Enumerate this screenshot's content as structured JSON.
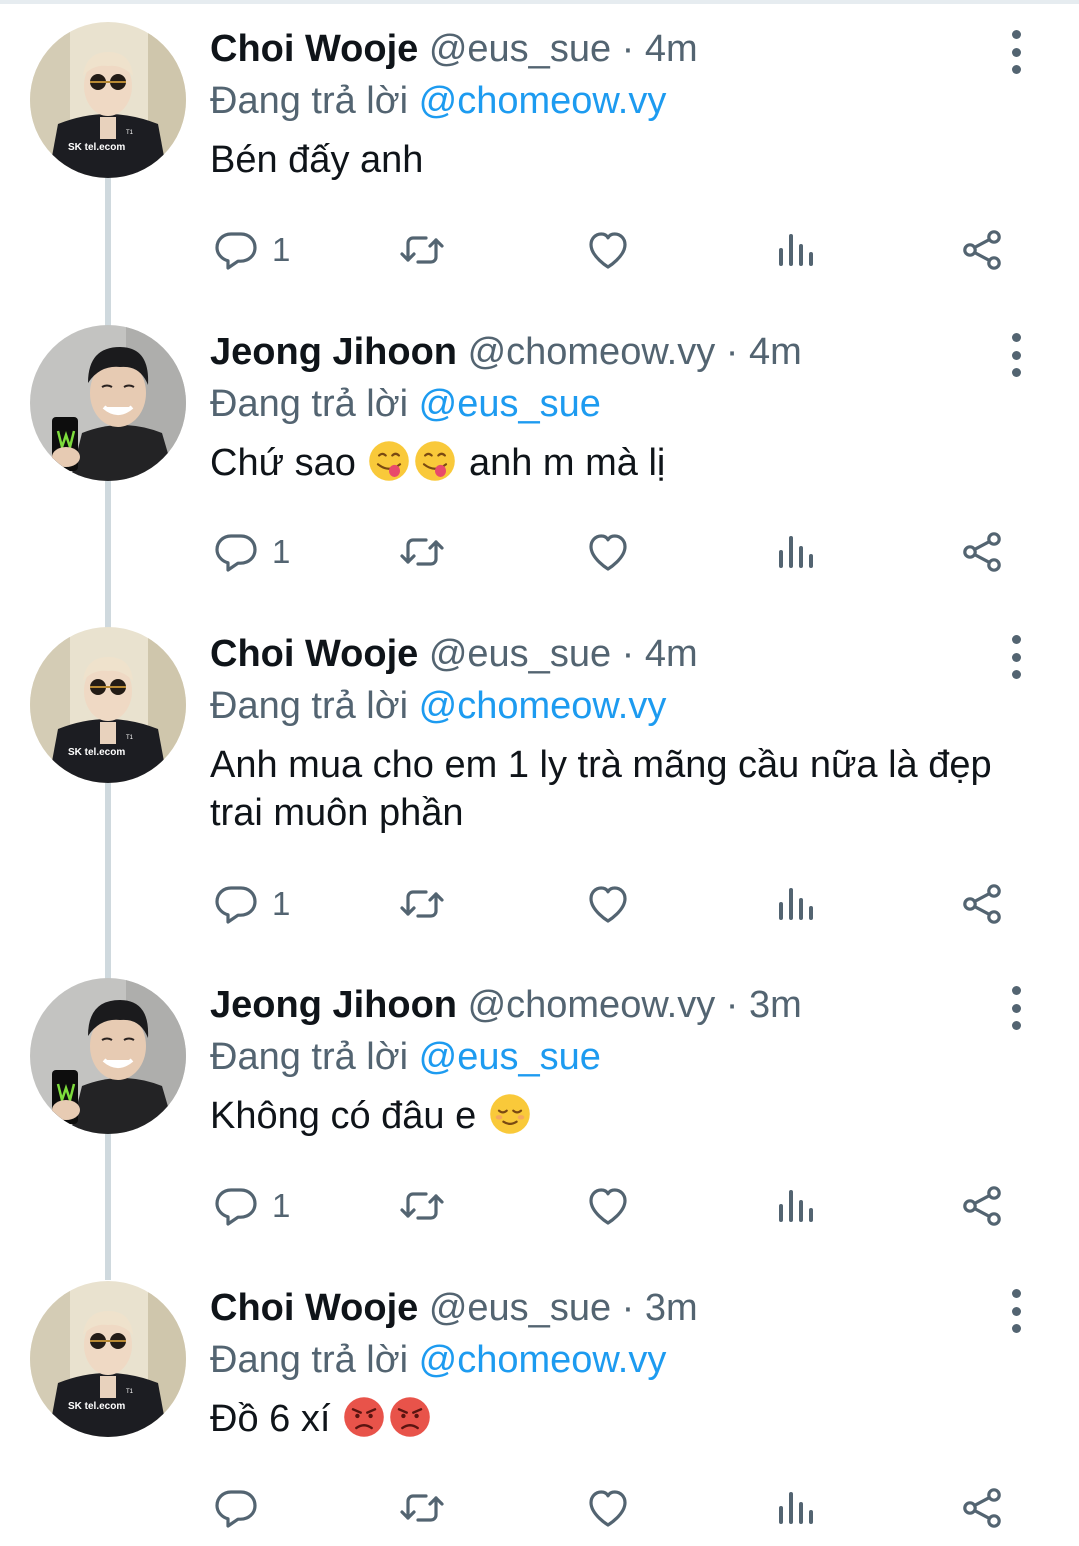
{
  "tweets": [
    {
      "name": "Choi Wooje",
      "handle": "@eus_sue",
      "dot": "·",
      "time": "4m",
      "replying_prefix": "Đang trả lời",
      "replying_to": "@chomeow.vy",
      "text_parts": [
        "Bén đấy anh"
      ],
      "reply_count": "1",
      "avatar": "choi-wooje-avatar"
    },
    {
      "name": "Jeong Jihoon",
      "handle": "@chomeow.vy",
      "dot": "·",
      "time": "4m",
      "replying_prefix": "Đang trả lời",
      "replying_to": "@eus_sue",
      "text_parts": [
        "Chứ sao ",
        " anh m mà lị"
      ],
      "reply_count": "1",
      "avatar": "jeong-jihoon-avatar"
    },
    {
      "name": "Choi Wooje",
      "handle": "@eus_sue",
      "dot": "·",
      "time": "4m",
      "replying_prefix": "Đang trả lời",
      "replying_to": "@chomeow.vy",
      "text_parts": [
        "Anh mua cho em 1 ly trà mãng cầu nữa là đẹp trai muôn phần"
      ],
      "reply_count": "1",
      "avatar": "choi-wooje-avatar"
    },
    {
      "name": "Jeong Jihoon",
      "handle": "@chomeow.vy",
      "dot": "·",
      "time": "3m",
      "replying_prefix": "Đang trả lời",
      "replying_to": "@eus_sue",
      "text_parts": [
        "Không có đâu e "
      ],
      "reply_count": "1",
      "avatar": "jeong-jihoon-avatar"
    },
    {
      "name": "Choi Wooje",
      "handle": "@eus_sue",
      "dot": "·",
      "time": "3m",
      "replying_prefix": "Đang trả lời",
      "replying_to": "@chomeow.vy",
      "text_parts": [
        "Đồ 6 xí "
      ],
      "reply_count": "",
      "avatar": "choi-wooje-avatar"
    }
  ],
  "icons": {
    "reply": "comment-icon",
    "retweet": "retweet-icon",
    "like": "heart-icon",
    "views": "analytics-icon",
    "share": "share-icon",
    "more": "more-vertical-icon"
  },
  "emojis": {
    "tweet_2": [
      "face-savoring-food-emoji",
      "face-savoring-food-emoji"
    ],
    "tweet_4": [
      "relieved-face-emoji"
    ],
    "tweet_5": [
      "angry-face-emoji",
      "angry-face-emoji"
    ]
  },
  "colors": {
    "text": "#0f1419",
    "secondary": "#536471",
    "link": "#1d9bf0",
    "thread_line": "#cfd9de"
  }
}
